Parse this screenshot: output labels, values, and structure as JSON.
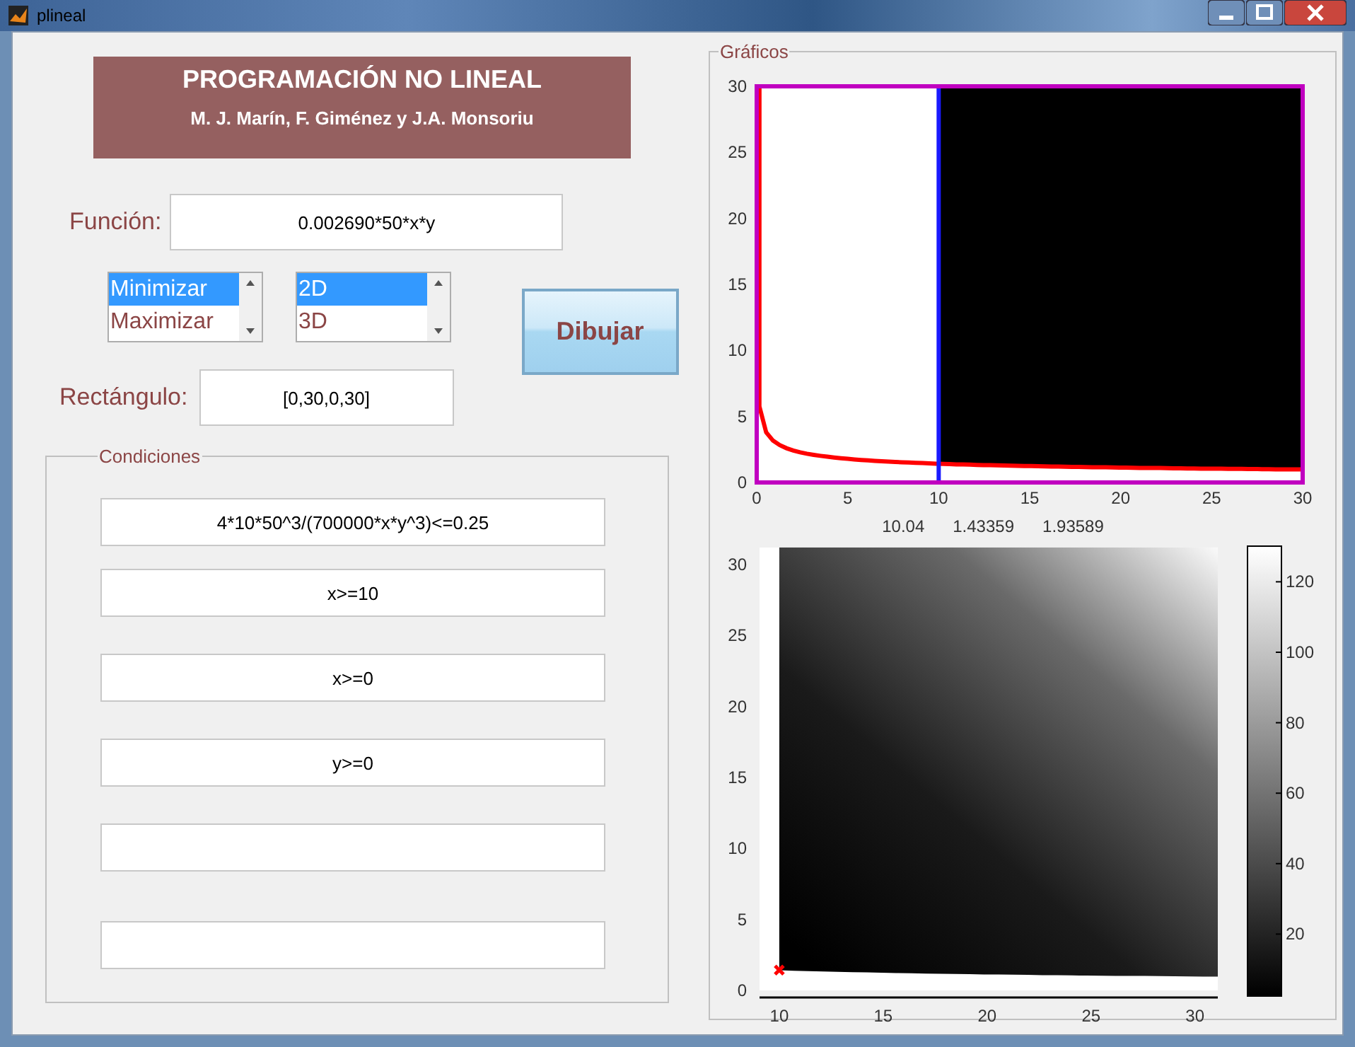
{
  "window": {
    "title": "plineal"
  },
  "header": {
    "title": "PROGRAMACIÓN NO LINEAL",
    "authors": "M. J. Marín, F. Giménez y J.A. Monsoriu"
  },
  "function": {
    "label": "Función:",
    "value": "0.002690*50*x*y"
  },
  "goal_list": [
    {
      "label": "Minimizar",
      "selected": true
    },
    {
      "label": "Maximizar",
      "selected": false
    }
  ],
  "dimension_list": [
    {
      "label": "2D",
      "selected": true
    },
    {
      "label": "3D",
      "selected": false
    }
  ],
  "draw_button": "Dibujar",
  "rectangle": {
    "label": "Rectángulo:",
    "value": "[0,30,0,30]"
  },
  "conditions": {
    "title": "Condiciones",
    "fields": [
      {
        "kind": "text",
        "value": "4*10*50^3/(700000*x*y^3)<=0.25"
      },
      {
        "kind": "text",
        "value": "x>=10"
      },
      {
        "kind": "text",
        "value": "x>=0"
      },
      {
        "kind": "text",
        "value": "y>=0"
      },
      {
        "kind": "empty"
      },
      {
        "kind": "empty"
      }
    ]
  },
  "graphics": {
    "title": "Gráficos",
    "region_plot": {
      "xticks": [
        "0",
        "5",
        "10",
        "15",
        "20",
        "25",
        "30"
      ],
      "yticks": [
        "30",
        "25",
        "20",
        "15",
        "10",
        "5",
        "0"
      ]
    },
    "readout": [
      "10.04",
      "1.43359",
      "1.93589"
    ],
    "level_plot": {
      "xticks": [
        "10",
        "15",
        "20",
        "25",
        "30"
      ],
      "yticks": [
        "30",
        "25",
        "20",
        "15",
        "10",
        "5",
        "0"
      ],
      "colorbar_ticks": [
        "120",
        "100",
        "80",
        "60",
        "40",
        "20"
      ]
    }
  }
}
